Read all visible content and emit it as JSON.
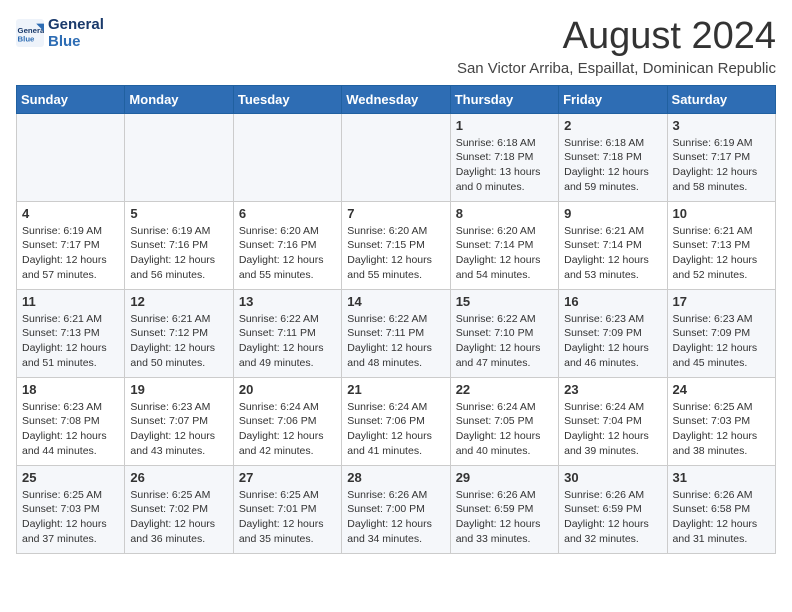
{
  "logo": {
    "line1": "General",
    "line2": "Blue"
  },
  "title": "August 2024",
  "subtitle": "San Victor Arriba, Espaillat, Dominican Republic",
  "weekdays": [
    "Sunday",
    "Monday",
    "Tuesday",
    "Wednesday",
    "Thursday",
    "Friday",
    "Saturday"
  ],
  "weeks": [
    [
      {
        "day": "",
        "info": ""
      },
      {
        "day": "",
        "info": ""
      },
      {
        "day": "",
        "info": ""
      },
      {
        "day": "",
        "info": ""
      },
      {
        "day": "1",
        "info": "Sunrise: 6:18 AM\nSunset: 7:18 PM\nDaylight: 13 hours\nand 0 minutes."
      },
      {
        "day": "2",
        "info": "Sunrise: 6:18 AM\nSunset: 7:18 PM\nDaylight: 12 hours\nand 59 minutes."
      },
      {
        "day": "3",
        "info": "Sunrise: 6:19 AM\nSunset: 7:17 PM\nDaylight: 12 hours\nand 58 minutes."
      }
    ],
    [
      {
        "day": "4",
        "info": "Sunrise: 6:19 AM\nSunset: 7:17 PM\nDaylight: 12 hours\nand 57 minutes."
      },
      {
        "day": "5",
        "info": "Sunrise: 6:19 AM\nSunset: 7:16 PM\nDaylight: 12 hours\nand 56 minutes."
      },
      {
        "day": "6",
        "info": "Sunrise: 6:20 AM\nSunset: 7:16 PM\nDaylight: 12 hours\nand 55 minutes."
      },
      {
        "day": "7",
        "info": "Sunrise: 6:20 AM\nSunset: 7:15 PM\nDaylight: 12 hours\nand 55 minutes."
      },
      {
        "day": "8",
        "info": "Sunrise: 6:20 AM\nSunset: 7:14 PM\nDaylight: 12 hours\nand 54 minutes."
      },
      {
        "day": "9",
        "info": "Sunrise: 6:21 AM\nSunset: 7:14 PM\nDaylight: 12 hours\nand 53 minutes."
      },
      {
        "day": "10",
        "info": "Sunrise: 6:21 AM\nSunset: 7:13 PM\nDaylight: 12 hours\nand 52 minutes."
      }
    ],
    [
      {
        "day": "11",
        "info": "Sunrise: 6:21 AM\nSunset: 7:13 PM\nDaylight: 12 hours\nand 51 minutes."
      },
      {
        "day": "12",
        "info": "Sunrise: 6:21 AM\nSunset: 7:12 PM\nDaylight: 12 hours\nand 50 minutes."
      },
      {
        "day": "13",
        "info": "Sunrise: 6:22 AM\nSunset: 7:11 PM\nDaylight: 12 hours\nand 49 minutes."
      },
      {
        "day": "14",
        "info": "Sunrise: 6:22 AM\nSunset: 7:11 PM\nDaylight: 12 hours\nand 48 minutes."
      },
      {
        "day": "15",
        "info": "Sunrise: 6:22 AM\nSunset: 7:10 PM\nDaylight: 12 hours\nand 47 minutes."
      },
      {
        "day": "16",
        "info": "Sunrise: 6:23 AM\nSunset: 7:09 PM\nDaylight: 12 hours\nand 46 minutes."
      },
      {
        "day": "17",
        "info": "Sunrise: 6:23 AM\nSunset: 7:09 PM\nDaylight: 12 hours\nand 45 minutes."
      }
    ],
    [
      {
        "day": "18",
        "info": "Sunrise: 6:23 AM\nSunset: 7:08 PM\nDaylight: 12 hours\nand 44 minutes."
      },
      {
        "day": "19",
        "info": "Sunrise: 6:23 AM\nSunset: 7:07 PM\nDaylight: 12 hours\nand 43 minutes."
      },
      {
        "day": "20",
        "info": "Sunrise: 6:24 AM\nSunset: 7:06 PM\nDaylight: 12 hours\nand 42 minutes."
      },
      {
        "day": "21",
        "info": "Sunrise: 6:24 AM\nSunset: 7:06 PM\nDaylight: 12 hours\nand 41 minutes."
      },
      {
        "day": "22",
        "info": "Sunrise: 6:24 AM\nSunset: 7:05 PM\nDaylight: 12 hours\nand 40 minutes."
      },
      {
        "day": "23",
        "info": "Sunrise: 6:24 AM\nSunset: 7:04 PM\nDaylight: 12 hours\nand 39 minutes."
      },
      {
        "day": "24",
        "info": "Sunrise: 6:25 AM\nSunset: 7:03 PM\nDaylight: 12 hours\nand 38 minutes."
      }
    ],
    [
      {
        "day": "25",
        "info": "Sunrise: 6:25 AM\nSunset: 7:03 PM\nDaylight: 12 hours\nand 37 minutes."
      },
      {
        "day": "26",
        "info": "Sunrise: 6:25 AM\nSunset: 7:02 PM\nDaylight: 12 hours\nand 36 minutes."
      },
      {
        "day": "27",
        "info": "Sunrise: 6:25 AM\nSunset: 7:01 PM\nDaylight: 12 hours\nand 35 minutes."
      },
      {
        "day": "28",
        "info": "Sunrise: 6:26 AM\nSunset: 7:00 PM\nDaylight: 12 hours\nand 34 minutes."
      },
      {
        "day": "29",
        "info": "Sunrise: 6:26 AM\nSunset: 6:59 PM\nDaylight: 12 hours\nand 33 minutes."
      },
      {
        "day": "30",
        "info": "Sunrise: 6:26 AM\nSunset: 6:59 PM\nDaylight: 12 hours\nand 32 minutes."
      },
      {
        "day": "31",
        "info": "Sunrise: 6:26 AM\nSunset: 6:58 PM\nDaylight: 12 hours\nand 31 minutes."
      }
    ]
  ]
}
